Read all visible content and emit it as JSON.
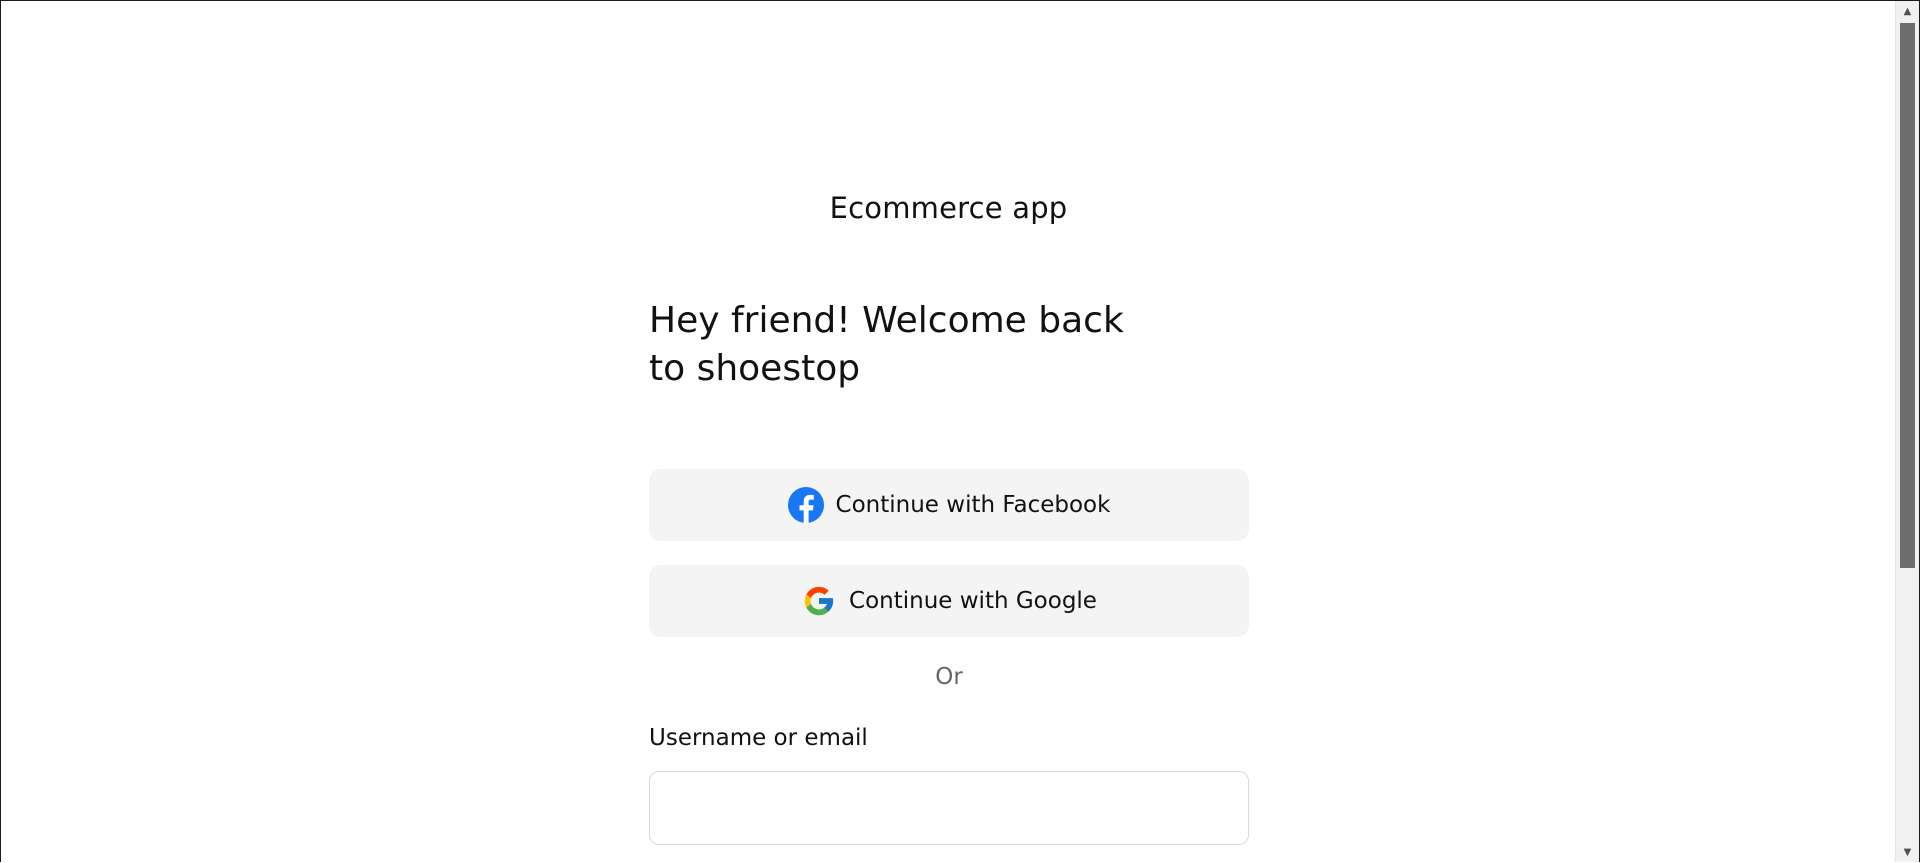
{
  "app": {
    "title": "Ecommerce app"
  },
  "login": {
    "welcome": "Hey friend! Welcome back to shoestop",
    "facebook_label": "Continue with Facebook",
    "google_label": "Continue with Google",
    "divider": "Or",
    "username_label": "Username or email",
    "username_value": "",
    "username_placeholder": ""
  },
  "icons": {
    "facebook": "facebook-icon",
    "google": "google-icon"
  },
  "colors": {
    "facebook_blue": "#1877F2",
    "google_blue": "#4285F4",
    "google_red": "#EA4335",
    "google_yellow": "#FBBC05",
    "google_green": "#34A853",
    "button_bg": "#f4f4f4",
    "divider_text": "#666666"
  }
}
